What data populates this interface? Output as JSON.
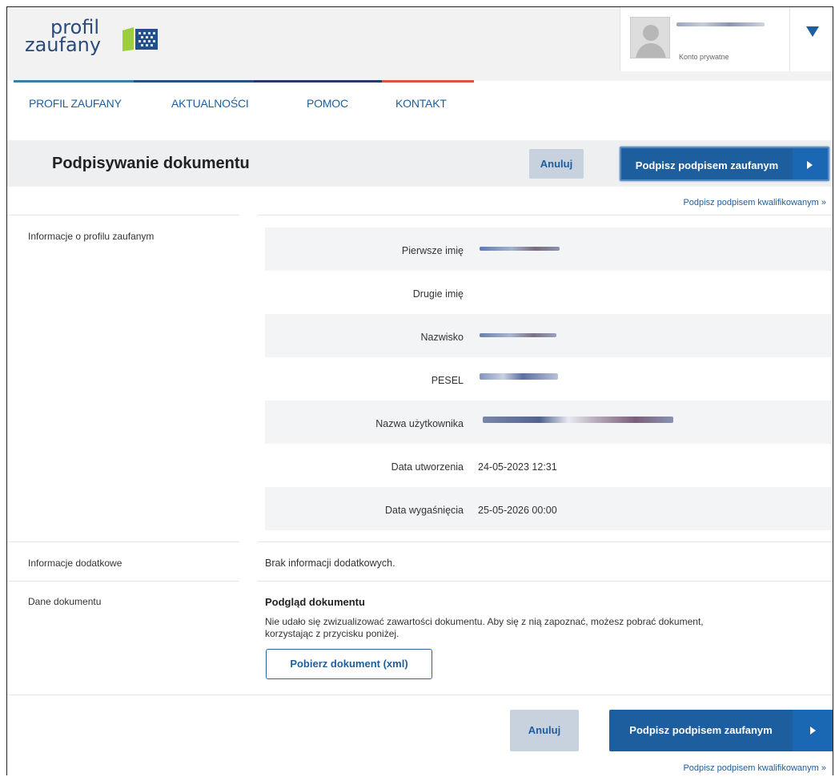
{
  "brand": {
    "logo_line1": "profil",
    "logo_line2": "zaufany"
  },
  "account": {
    "type_label": "Konto prywatne",
    "avatar_icon": "user-avatar-icon",
    "toggle_icon": "triangle-down-icon"
  },
  "nav": {
    "items": [
      "PROFIL ZAUFANY",
      "AKTUALNOŚCI",
      "POMOC",
      "KONTAKT"
    ]
  },
  "page": {
    "title": "Podpisywanie dokumentu"
  },
  "actions": {
    "cancel_label": "Anuluj",
    "sign_label": "Podpisz podpisem zaufanym",
    "qualified_link": "Podpisz podpisem kwalifikowanym »",
    "arrow_icon": "arrow-right-icon"
  },
  "profile_info": {
    "section_label": "Informacje o profilu zaufanym",
    "fields": [
      {
        "label": "Pierwsze imię",
        "value": ""
      },
      {
        "label": "Drugie imię",
        "value": ""
      },
      {
        "label": "Nazwisko",
        "value": ""
      },
      {
        "label": "PESEL",
        "value": ""
      },
      {
        "label": "Nazwa użytkownika",
        "value": ""
      },
      {
        "label": "Data utworzenia",
        "value": "24-05-2023 12:31"
      },
      {
        "label": "Data wygaśnięcia",
        "value": "25-05-2026 00:00"
      }
    ]
  },
  "additional_info": {
    "section_label": "Informacje dodatkowe",
    "text": "Brak informacji dodatkowych."
  },
  "document": {
    "section_label": "Dane dokumentu",
    "preview_title": "Podgląd dokumentu",
    "preview_message_line1": "Nie udało się zwizualizować zawartości dokumentu. Aby się z nią zapoznać, możesz pobrać dokument,",
    "preview_message_line2": "korzystając z przycisku poniżej.",
    "download_label": "Pobierz dokument (xml)"
  },
  "colors": {
    "brand_blue": "#1d5e9f",
    "cancel_bg": "#c7d2de",
    "row_shade": "#f3f4f5",
    "logo_green": "#9ccd3d"
  }
}
